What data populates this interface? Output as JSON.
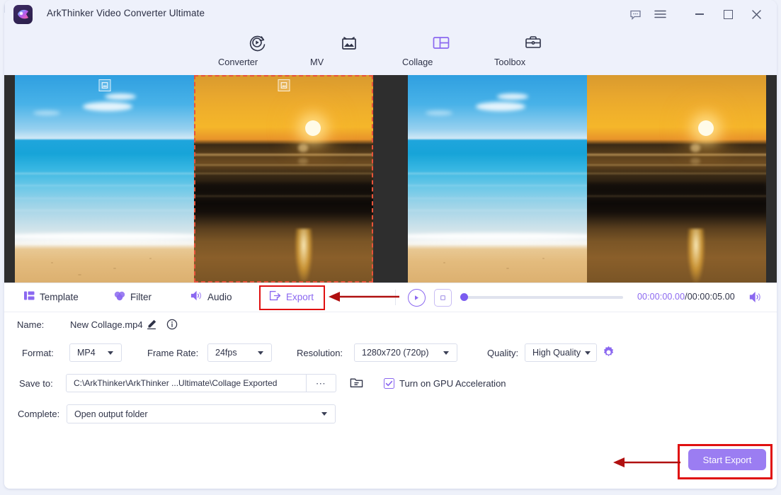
{
  "window": {
    "app_title": "ArkThinker Video Converter Ultimate",
    "controls": {
      "feedback": "feedback-icon",
      "menu": "menu-icon",
      "minimize": "—",
      "maximize": "□",
      "close": "✕"
    }
  },
  "nav": {
    "tabs": [
      {
        "label": "Converter",
        "icon": "converter-icon",
        "active": false
      },
      {
        "label": "MV",
        "icon": "mv-icon",
        "active": false
      },
      {
        "label": "Collage",
        "icon": "collage-icon",
        "active": true
      },
      {
        "label": "Toolbox",
        "icon": "toolbox-icon",
        "active": false
      }
    ]
  },
  "preview": {
    "edit_cells": [
      {
        "name": "ocean-beach-clip",
        "selected": false,
        "badge": "image-badge-icon"
      },
      {
        "name": "sunset-beach-clip",
        "selected": true,
        "badge": "image-badge-icon"
      }
    ],
    "preview_cells": [
      {
        "name": "ocean-beach-clip"
      },
      {
        "name": "sunset-beach-clip"
      }
    ]
  },
  "toolbar": {
    "template_label": "Template",
    "filter_label": "Filter",
    "audio_label": "Audio",
    "export_label": "Export",
    "time_current": "00:00:00.00",
    "time_total": "/00:00:05.00",
    "progress_percent": 0
  },
  "settings": {
    "name_label": "Name:",
    "name_value": "New Collage.mp4",
    "format_label": "Format:",
    "format_value": "MP4",
    "frame_rate_label": "Frame Rate:",
    "frame_rate_value": "24fps",
    "resolution_label": "Resolution:",
    "resolution_value": "1280x720 (720p)",
    "quality_label": "Quality:",
    "quality_value": "High Quality",
    "save_to_label": "Save to:",
    "save_to_value": "C:\\ArkThinker\\ArkThinker ...Ultimate\\Collage Exported",
    "browse_label": "⋯",
    "gpu_label": "Turn on GPU Acceleration",
    "gpu_checked": true,
    "complete_label": "Complete:",
    "complete_value": "Open output folder",
    "start_export_label": "Start Export"
  },
  "colors": {
    "accent": "#8b68f0",
    "accent_button": "#9b7df2",
    "highlight": "#e01010",
    "selection_dash": "#e8533a",
    "titlebar_bg": "#eef1fb",
    "preview_bg": "#2e2e2e"
  }
}
